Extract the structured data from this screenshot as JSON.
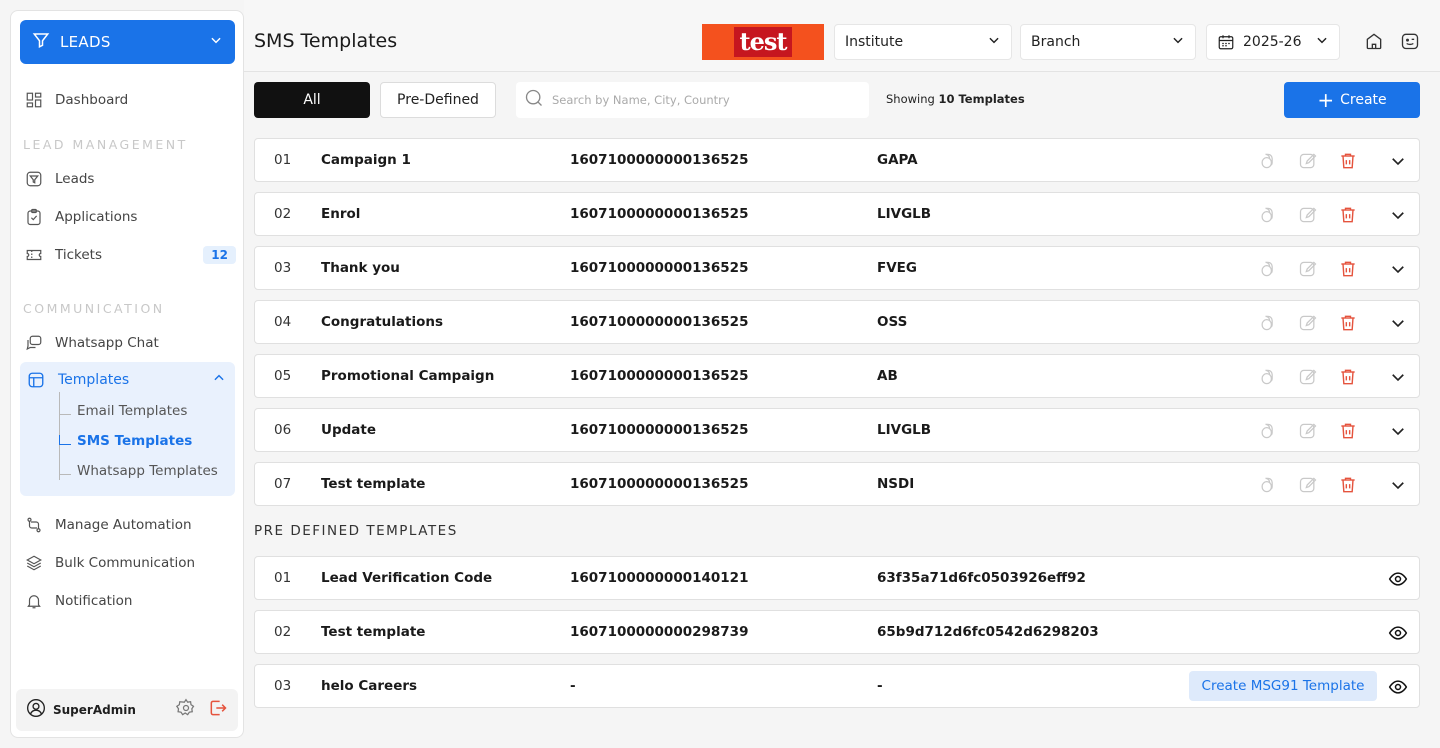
{
  "sidebar": {
    "leads_label": "LEADS",
    "dashboard": "Dashboard",
    "lead_mgmt_label": "LEAD MANAGEMENT",
    "leads": "Leads",
    "applications": "Applications",
    "tickets": "Tickets",
    "tickets_count": "12",
    "communication_label": "COMMUNICATION",
    "whatsapp_chat": "Whatsapp Chat",
    "templates": "Templates",
    "email_templates": "Email Templates",
    "sms_templates": "SMS Templates",
    "whatsapp_templates": "Whatsapp Templates",
    "manage_automation": "Manage Automation",
    "bulk_communication": "Bulk Communication",
    "notification": "Notification",
    "user_name": "SuperAdmin"
  },
  "header": {
    "title": "SMS Templates",
    "brand_text": "test",
    "institute": "Institute",
    "branch": "Branch",
    "year": "2025-26"
  },
  "toolbar": {
    "tab_all": "All",
    "tab_predefined": "Pre-Defined",
    "search_placeholder": "Search by Name, City, Country",
    "showing_prefix": "Showing",
    "showing_count": "10 Templates",
    "create": "Create"
  },
  "templates": [
    {
      "num": "01",
      "name": "Campaign 1",
      "dlt": "1607100000000136525",
      "code": "GAPA"
    },
    {
      "num": "02",
      "name": "Enrol",
      "dlt": "1607100000000136525",
      "code": "LIVGLB"
    },
    {
      "num": "03",
      "name": "Thank you",
      "dlt": "1607100000000136525",
      "code": "FVEG"
    },
    {
      "num": "04",
      "name": "Congratulations",
      "dlt": "1607100000000136525",
      "code": "OSS"
    },
    {
      "num": "05",
      "name": "Promotional Campaign",
      "dlt": "1607100000000136525",
      "code": "AB"
    },
    {
      "num": "06",
      "name": "Update",
      "dlt": "1607100000000136525",
      "code": "LIVGLB"
    },
    {
      "num": "07",
      "name": "Test template",
      "dlt": "1607100000000136525",
      "code": "NSDI"
    }
  ],
  "predefined_title": "PRE DEFINED TEMPLATES",
  "predefined": [
    {
      "num": "01",
      "name": "Lead Verification Code",
      "dlt": "1607100000000140121",
      "code": "63f35a71d6fc0503926eff92"
    },
    {
      "num": "02",
      "name": "Test template",
      "dlt": "1607100000000298739",
      "code": "65b9d712d6fc0542d6298203"
    },
    {
      "num": "03",
      "name": "helo Careers",
      "dlt": "-",
      "code": "-",
      "button": "Create MSG91 Template"
    }
  ],
  "colors": {
    "accent": "#1a73e8",
    "danger": "#e5533d",
    "brand_bg": "#f4511e",
    "brand_red": "#c6161f"
  }
}
